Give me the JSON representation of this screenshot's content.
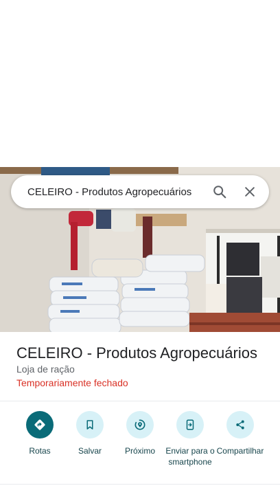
{
  "search": {
    "query": "CELEIRO - Produtos Agropecuários"
  },
  "place": {
    "name": "CELEIRO - Produtos Agropecuários",
    "category": "Loja de ração",
    "status": "Temporariamente fechado"
  },
  "actions": [
    {
      "label": "Rotas",
      "icon": "directions-icon"
    },
    {
      "label": "Salvar",
      "icon": "bookmark-icon"
    },
    {
      "label": "Próximo",
      "icon": "nearby-icon"
    },
    {
      "label": "Enviar para o smartphone",
      "icon": "send-to-phone-icon"
    },
    {
      "label": "Compartilhar",
      "icon": "share-icon"
    }
  ],
  "colors": {
    "primary_action": "#0a6b78",
    "action_bg": "#d7f1f7",
    "status_closed": "#d93025",
    "action_label": "#17454c"
  }
}
